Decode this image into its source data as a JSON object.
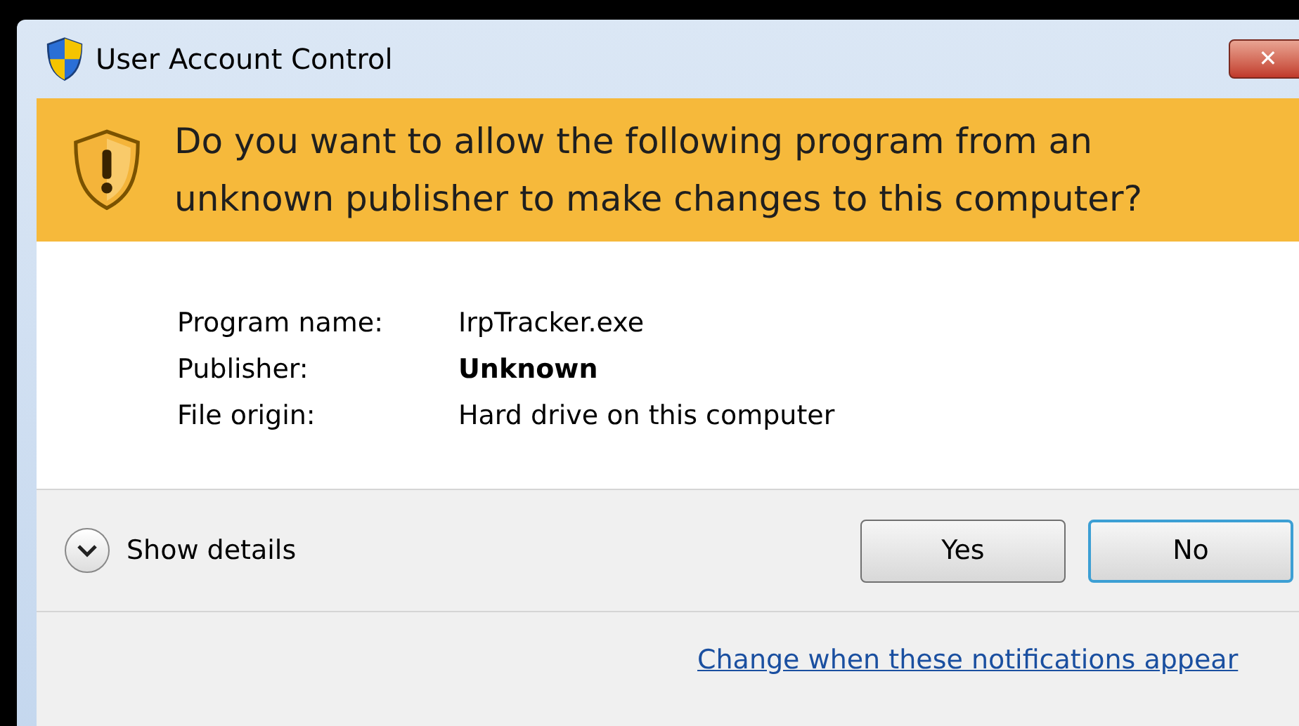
{
  "window": {
    "title": "User Account Control",
    "close_label": "✕"
  },
  "banner": {
    "question": "Do you want to allow the following program from an unknown publisher to make changes to this computer?"
  },
  "details": [
    {
      "label": "Program name:",
      "value": "IrpTracker.exe",
      "bold": false
    },
    {
      "label": "Publisher:",
      "value": "Unknown",
      "bold": true
    },
    {
      "label": "File origin:",
      "value": "Hard drive on this computer",
      "bold": false
    }
  ],
  "show_details": {
    "label": "Show details",
    "expanded": false
  },
  "buttons": [
    {
      "label": "Yes",
      "default": false
    },
    {
      "label": "No",
      "default": true
    }
  ],
  "link": "Change when these notifications appear"
}
